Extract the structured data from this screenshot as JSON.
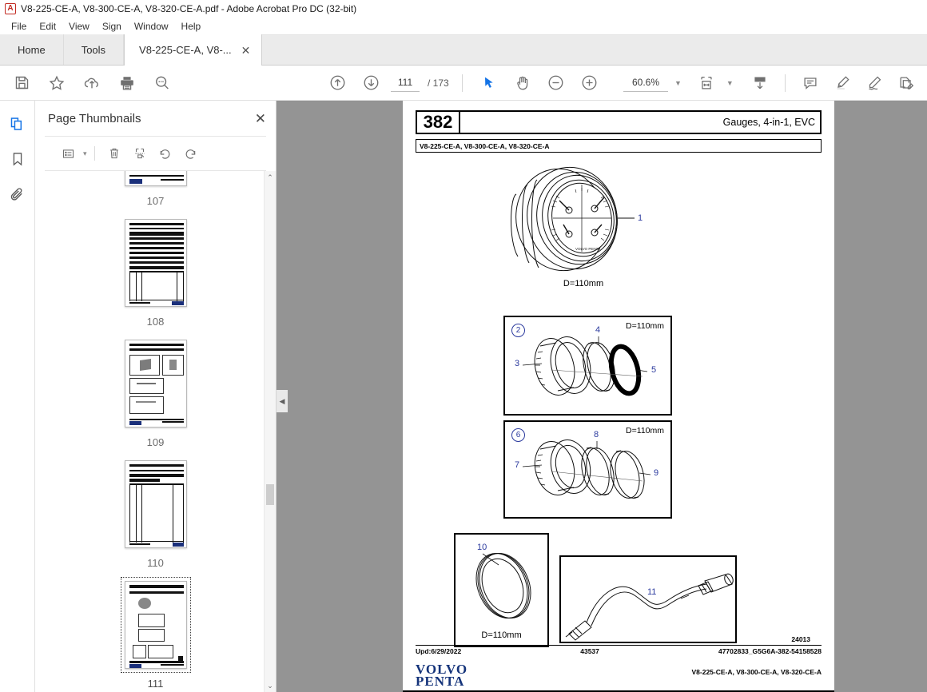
{
  "window": {
    "title": "V8-225-CE-A, V8-300-CE-A, V8-320-CE-A.pdf - Adobe Acrobat Pro DC (32-bit)",
    "app_icon": "acrobat-icon"
  },
  "menubar": {
    "items": [
      "File",
      "Edit",
      "View",
      "Sign",
      "Window",
      "Help"
    ]
  },
  "tabs": [
    {
      "label": "Home",
      "closable": false,
      "active": false
    },
    {
      "label": "Tools",
      "closable": false,
      "active": false
    },
    {
      "label": "V8-225-CE-A, V8-...",
      "closable": true,
      "active": true,
      "close_glyph": "✕"
    }
  ],
  "toolbar": {
    "left_icons": [
      "save-icon",
      "star-icon",
      "upload-cloud-icon",
      "print-icon",
      "zoom-search-icon"
    ],
    "nav": {
      "previous_page_icon": "arrow-up-circle-icon",
      "next_page_icon": "arrow-down-circle-icon",
      "page_value": "111",
      "page_total": "/ 173"
    },
    "tools": {
      "select_icon": "cursor-arrow-icon",
      "hand_icon": "hand-icon",
      "zoom_out_icon": "minus-circle-icon",
      "zoom_in_icon": "plus-circle-icon"
    },
    "zoom_value": "60.6%",
    "zoom_caret": "▼",
    "fit_page_icon": "fit-width-icon",
    "fit_caret": "▼",
    "scroll_mode_icon": "page-down-icon",
    "right_icons": [
      "comment-icon",
      "highlight-icon",
      "sign-icon",
      "edit-pdf-icon"
    ]
  },
  "rail": {
    "items": [
      {
        "name": "page-thumbnails-icon",
        "active": true
      },
      {
        "name": "bookmarks-icon",
        "active": false
      },
      {
        "name": "attachments-icon",
        "active": false
      }
    ]
  },
  "thumbnails_panel": {
    "title": "Page Thumbnails",
    "close_glyph": "✕",
    "toolbar": {
      "options_icon": "list-options-icon",
      "options_caret": "▾",
      "delete_icon": "trash-icon",
      "extract_icon": "extract-pages-icon",
      "rotate_ccw_icon": "rotate-counterclockwise-icon",
      "rotate_cw_icon": "rotate-clockwise-icon"
    },
    "pages": [
      {
        "label": "107",
        "selected": false,
        "kind": "table-partial"
      },
      {
        "label": "108",
        "selected": false,
        "kind": "table"
      },
      {
        "label": "109",
        "selected": false,
        "kind": "figures"
      },
      {
        "label": "110",
        "selected": false,
        "kind": "table-sparse"
      },
      {
        "label": "111",
        "selected": true,
        "kind": "gauges"
      }
    ],
    "scrollbar": {
      "up_glyph": "⌃",
      "down_glyph": "⌄"
    }
  },
  "viewer": {
    "collapse_glyph": "◀",
    "background_color": "#949494"
  },
  "document_page": {
    "header": {
      "page_number": "382",
      "section_title": "Gauges, 4-in-1, EVC",
      "models": "V8-225-CE-A, V8-300-CE-A, V8-320-CE-A"
    },
    "figures": {
      "main_gauge": {
        "callout": "1",
        "dimension": "D=110mm"
      },
      "box_2": {
        "circle_number": "2",
        "dimension": "D=110mm",
        "callouts": [
          "3",
          "4",
          "5"
        ]
      },
      "box_6": {
        "circle_number": "6",
        "dimension": "D=110mm",
        "callouts": [
          "7",
          "8",
          "9"
        ]
      },
      "box_10": {
        "callout": "10",
        "dimension": "D=110mm"
      },
      "box_11": {
        "callout": "11"
      }
    },
    "footer": {
      "drawing_code": "24013",
      "updated": "Upd:6/29/2022",
      "center_number": "43537",
      "part_reference": "47702833_G5G6A-382-54158528",
      "brand_line1": "VOLVO",
      "brand_line2": "PENTA",
      "models": "V8-225-CE-A, V8-300-CE-A, V8-320-CE-A"
    }
  },
  "colors": {
    "accent": "#1473e6",
    "callout_blue": "#2b3a9e",
    "volvo_blue": "#14337a",
    "viewer_gray": "#949494"
  }
}
